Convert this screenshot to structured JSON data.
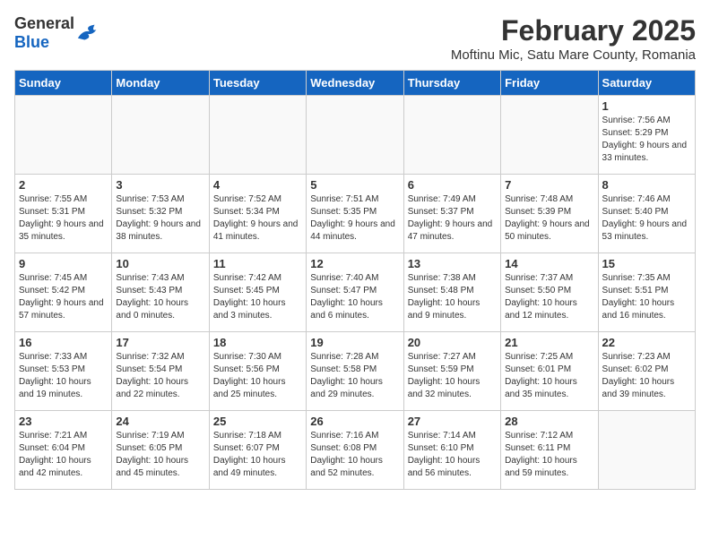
{
  "header": {
    "logo_general": "General",
    "logo_blue": "Blue",
    "title": "February 2025",
    "subtitle": "Moftinu Mic, Satu Mare County, Romania"
  },
  "days_of_week": [
    "Sunday",
    "Monday",
    "Tuesday",
    "Wednesday",
    "Thursday",
    "Friday",
    "Saturday"
  ],
  "weeks": [
    [
      {
        "day": "",
        "info": ""
      },
      {
        "day": "",
        "info": ""
      },
      {
        "day": "",
        "info": ""
      },
      {
        "day": "",
        "info": ""
      },
      {
        "day": "",
        "info": ""
      },
      {
        "day": "",
        "info": ""
      },
      {
        "day": "1",
        "info": "Sunrise: 7:56 AM\nSunset: 5:29 PM\nDaylight: 9 hours and 33 minutes."
      }
    ],
    [
      {
        "day": "2",
        "info": "Sunrise: 7:55 AM\nSunset: 5:31 PM\nDaylight: 9 hours and 35 minutes."
      },
      {
        "day": "3",
        "info": "Sunrise: 7:53 AM\nSunset: 5:32 PM\nDaylight: 9 hours and 38 minutes."
      },
      {
        "day": "4",
        "info": "Sunrise: 7:52 AM\nSunset: 5:34 PM\nDaylight: 9 hours and 41 minutes."
      },
      {
        "day": "5",
        "info": "Sunrise: 7:51 AM\nSunset: 5:35 PM\nDaylight: 9 hours and 44 minutes."
      },
      {
        "day": "6",
        "info": "Sunrise: 7:49 AM\nSunset: 5:37 PM\nDaylight: 9 hours and 47 minutes."
      },
      {
        "day": "7",
        "info": "Sunrise: 7:48 AM\nSunset: 5:39 PM\nDaylight: 9 hours and 50 minutes."
      },
      {
        "day": "8",
        "info": "Sunrise: 7:46 AM\nSunset: 5:40 PM\nDaylight: 9 hours and 53 minutes."
      }
    ],
    [
      {
        "day": "9",
        "info": "Sunrise: 7:45 AM\nSunset: 5:42 PM\nDaylight: 9 hours and 57 minutes."
      },
      {
        "day": "10",
        "info": "Sunrise: 7:43 AM\nSunset: 5:43 PM\nDaylight: 10 hours and 0 minutes."
      },
      {
        "day": "11",
        "info": "Sunrise: 7:42 AM\nSunset: 5:45 PM\nDaylight: 10 hours and 3 minutes."
      },
      {
        "day": "12",
        "info": "Sunrise: 7:40 AM\nSunset: 5:47 PM\nDaylight: 10 hours and 6 minutes."
      },
      {
        "day": "13",
        "info": "Sunrise: 7:38 AM\nSunset: 5:48 PM\nDaylight: 10 hours and 9 minutes."
      },
      {
        "day": "14",
        "info": "Sunrise: 7:37 AM\nSunset: 5:50 PM\nDaylight: 10 hours and 12 minutes."
      },
      {
        "day": "15",
        "info": "Sunrise: 7:35 AM\nSunset: 5:51 PM\nDaylight: 10 hours and 16 minutes."
      }
    ],
    [
      {
        "day": "16",
        "info": "Sunrise: 7:33 AM\nSunset: 5:53 PM\nDaylight: 10 hours and 19 minutes."
      },
      {
        "day": "17",
        "info": "Sunrise: 7:32 AM\nSunset: 5:54 PM\nDaylight: 10 hours and 22 minutes."
      },
      {
        "day": "18",
        "info": "Sunrise: 7:30 AM\nSunset: 5:56 PM\nDaylight: 10 hours and 25 minutes."
      },
      {
        "day": "19",
        "info": "Sunrise: 7:28 AM\nSunset: 5:58 PM\nDaylight: 10 hours and 29 minutes."
      },
      {
        "day": "20",
        "info": "Sunrise: 7:27 AM\nSunset: 5:59 PM\nDaylight: 10 hours and 32 minutes."
      },
      {
        "day": "21",
        "info": "Sunrise: 7:25 AM\nSunset: 6:01 PM\nDaylight: 10 hours and 35 minutes."
      },
      {
        "day": "22",
        "info": "Sunrise: 7:23 AM\nSunset: 6:02 PM\nDaylight: 10 hours and 39 minutes."
      }
    ],
    [
      {
        "day": "23",
        "info": "Sunrise: 7:21 AM\nSunset: 6:04 PM\nDaylight: 10 hours and 42 minutes."
      },
      {
        "day": "24",
        "info": "Sunrise: 7:19 AM\nSunset: 6:05 PM\nDaylight: 10 hours and 45 minutes."
      },
      {
        "day": "25",
        "info": "Sunrise: 7:18 AM\nSunset: 6:07 PM\nDaylight: 10 hours and 49 minutes."
      },
      {
        "day": "26",
        "info": "Sunrise: 7:16 AM\nSunset: 6:08 PM\nDaylight: 10 hours and 52 minutes."
      },
      {
        "day": "27",
        "info": "Sunrise: 7:14 AM\nSunset: 6:10 PM\nDaylight: 10 hours and 56 minutes."
      },
      {
        "day": "28",
        "info": "Sunrise: 7:12 AM\nSunset: 6:11 PM\nDaylight: 10 hours and 59 minutes."
      },
      {
        "day": "",
        "info": ""
      }
    ]
  ]
}
